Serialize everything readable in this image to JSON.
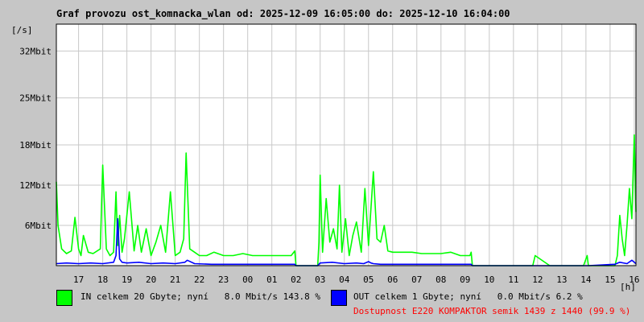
{
  "page": {
    "title": "Graf provozu ost_komnacka_wlan od: 2025-12-09 16:05:00 do: 2025-12-10 16:04:00",
    "y_unit": "[/s]",
    "x_unit": "[h]"
  },
  "legend": {
    "in_text": "IN celkem 20 Gbyte; nyní   8.0 Mbit/s 143.8 %",
    "out_text": "OUT celkem 1 Gbyte; nyní   0.0 Mbit/s 6.2 %",
    "availability": "Dostupnost E220 KOMPAKTOR semik 1439 z 1440 (99.9 %)",
    "in_color": "#00ff00",
    "out_color": "#0000ff",
    "availability_color": "#ff0000"
  },
  "chart_data": {
    "type": "line",
    "ylim": [
      0,
      36
    ],
    "ytick_values": [
      6,
      12,
      18,
      25,
      32
    ],
    "ytick_labels": [
      "6Mbit",
      "12Mbit",
      "18Mbit",
      "25Mbit",
      "32Mbit"
    ],
    "xlim": [
      16.08,
      40.07
    ],
    "xtick_values": [
      17,
      18,
      19,
      20,
      21,
      22,
      23,
      24,
      25,
      26,
      27,
      28,
      29,
      30,
      31,
      32,
      33,
      34,
      35,
      36,
      37,
      38,
      39,
      40
    ],
    "xtick_labels": [
      "17",
      "18",
      "19",
      "20",
      "21",
      "22",
      "23",
      "00",
      "01",
      "02",
      "03",
      "04",
      "05",
      "06",
      "07",
      "08",
      "09",
      "10",
      "11",
      "12",
      "13",
      "14",
      "15",
      "16"
    ],
    "grid": true,
    "series": [
      {
        "name": "IN",
        "color": "#00ff00",
        "x": [
          16.08,
          16.15,
          16.3,
          16.5,
          16.7,
          16.85,
          17.0,
          17.1,
          17.2,
          17.4,
          17.6,
          17.9,
          18.0,
          18.15,
          18.3,
          18.45,
          18.55,
          18.62,
          18.7,
          18.8,
          18.9,
          19.1,
          19.3,
          19.45,
          19.6,
          19.8,
          20.0,
          20.2,
          20.4,
          20.6,
          20.8,
          21.0,
          21.2,
          21.35,
          21.45,
          21.6,
          21.8,
          22.0,
          22.3,
          22.6,
          23.0,
          23.4,
          23.8,
          24.2,
          24.6,
          25.0,
          25.4,
          25.8,
          25.95,
          26.0,
          26.5,
          26.9,
          26.95,
          27.0,
          27.1,
          27.25,
          27.4,
          27.55,
          27.7,
          27.8,
          27.9,
          28.05,
          28.2,
          28.35,
          28.5,
          28.7,
          28.85,
          29.0,
          29.2,
          29.35,
          29.5,
          29.65,
          29.8,
          30.0,
          30.4,
          30.8,
          31.2,
          31.6,
          32.0,
          32.4,
          32.8,
          33.2,
          33.25,
          33.3,
          33.8,
          34.4,
          35.0,
          35.6,
          35.8,
          35.9,
          36.5,
          37.0,
          37.5,
          37.9,
          38.05,
          38.1,
          38.2,
          38.5,
          39.0,
          39.2,
          39.3,
          39.4,
          39.5,
          39.6,
          39.7,
          39.8,
          39.9,
          40.0,
          40.07
        ],
        "values": [
          12.5,
          6.0,
          2.5,
          1.8,
          2.2,
          7.2,
          2.5,
          1.5,
          4.5,
          2.0,
          1.8,
          2.5,
          15.0,
          2.5,
          1.5,
          2.0,
          11.0,
          3.0,
          7.5,
          2.0,
          4.0,
          11.0,
          2.2,
          6.0,
          2.0,
          5.5,
          1.5,
          3.5,
          6.0,
          2.0,
          11.0,
          1.5,
          2.0,
          4.0,
          16.8,
          2.5,
          2.0,
          1.5,
          1.5,
          2.0,
          1.5,
          1.5,
          1.8,
          1.5,
          1.5,
          1.5,
          1.5,
          1.5,
          2.2,
          0.0,
          0.0,
          0.0,
          3.5,
          13.5,
          2.0,
          10.0,
          3.5,
          5.5,
          2.5,
          12.0,
          2.0,
          7.0,
          1.5,
          4.5,
          6.5,
          2.0,
          11.5,
          3.0,
          14.0,
          4.0,
          3.5,
          6.0,
          2.2,
          2.0,
          2.0,
          2.0,
          1.8,
          1.8,
          1.8,
          2.0,
          1.5,
          1.5,
          2.0,
          0.0,
          0.0,
          0.0,
          0.0,
          0.0,
          0.0,
          1.5,
          0.0,
          0.0,
          0.0,
          0.0,
          1.5,
          0.0,
          0.0,
          0.0,
          0.0,
          0.0,
          1.5,
          7.5,
          4.0,
          1.5,
          6.0,
          11.5,
          7.0,
          19.5,
          8.0
        ]
      },
      {
        "name": "OUT",
        "color": "#0000ff",
        "x": [
          16.08,
          16.5,
          17.0,
          17.5,
          18.0,
          18.45,
          18.55,
          18.62,
          18.7,
          18.8,
          19.0,
          19.5,
          20.0,
          20.5,
          21.0,
          21.4,
          21.5,
          21.8,
          22.5,
          23.5,
          24.5,
          25.5,
          25.95,
          26.0,
          26.9,
          26.95,
          27.0,
          27.5,
          28.0,
          28.5,
          28.8,
          29.0,
          29.1,
          29.2,
          29.5,
          30.0,
          31.0,
          32.0,
          33.0,
          33.25,
          33.3,
          38.05,
          38.1,
          39.2,
          39.4,
          39.7,
          39.9,
          40.07
        ],
        "values": [
          0.3,
          0.4,
          0.3,
          0.4,
          0.3,
          0.5,
          1.5,
          7.0,
          1.0,
          0.5,
          0.4,
          0.5,
          0.3,
          0.4,
          0.3,
          0.5,
          0.8,
          0.3,
          0.2,
          0.2,
          0.2,
          0.2,
          0.2,
          0.0,
          0.0,
          0.2,
          0.4,
          0.5,
          0.3,
          0.4,
          0.3,
          0.6,
          0.4,
          0.3,
          0.2,
          0.2,
          0.2,
          0.2,
          0.2,
          0.2,
          0.0,
          0.0,
          0.0,
          0.2,
          0.5,
          0.3,
          0.8,
          0.3
        ]
      }
    ]
  }
}
